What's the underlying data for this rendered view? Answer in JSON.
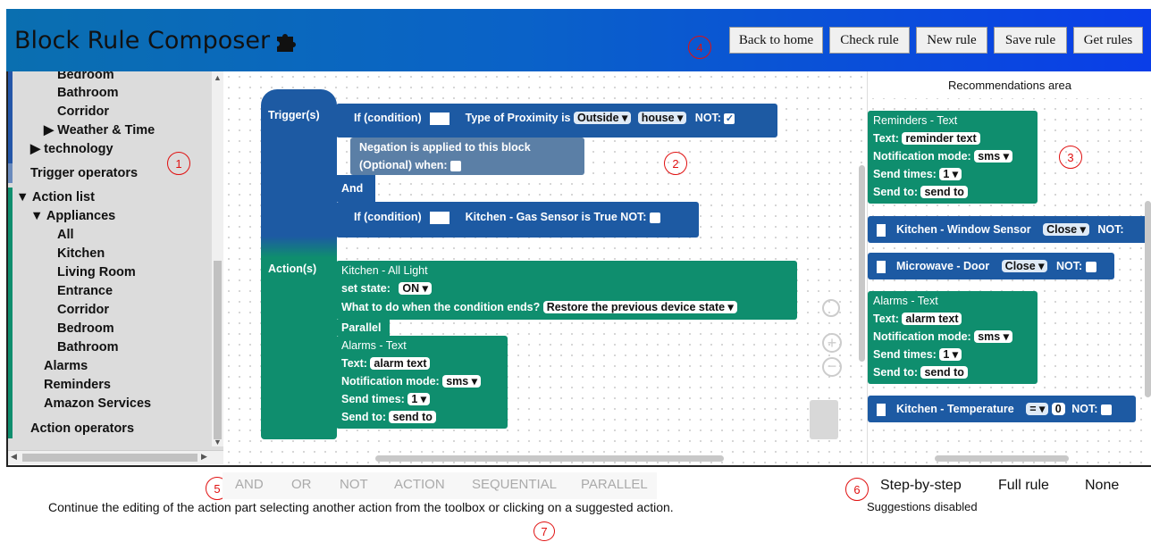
{
  "header": {
    "title": "Block Rule Composer",
    "buttons": [
      "Back to home",
      "Check rule",
      "New rule",
      "Save rule",
      "Get rules"
    ],
    "icon": "puzzle-piece-icon"
  },
  "markers": [
    "1",
    "2",
    "3",
    "4",
    "5",
    "6",
    "7"
  ],
  "toolbox": {
    "items": [
      "Bedroom",
      "Bathroom",
      "Corridor",
      "▶ Weather & Time",
      "▶ technology",
      "Trigger operators",
      "▼ Action list",
      "▼ Appliances",
      "All",
      "Kitchen",
      "Living Room",
      "Entrance",
      "Corridor",
      "Bedroom",
      "Bathroom",
      "Alarms",
      "Reminders",
      "Amazon Services",
      "Action operators"
    ]
  },
  "canvas": {
    "triggers_label": "Trigger(s)",
    "actions_label": "Action(s)",
    "if1": {
      "label": "If (condition)",
      "text": "Type of Proximity  is",
      "dd1": "Outside ▾",
      "dd2": "house ▾",
      "not": "NOT:",
      "check": "✓"
    },
    "negation": {
      "line1": "Negation is applied to this block",
      "line2": "(Optional) when:"
    },
    "and_label": "And",
    "if2": {
      "label": "If (condition)",
      "text": "Kitchen - Gas Sensor  is  True   NOT:"
    },
    "action1": {
      "title": "Kitchen - All Light",
      "set_state": "set state:",
      "state_dd": "ON ▾",
      "end_q": "What to do when the condition ends?",
      "end_dd": "Restore the previous device state ▾"
    },
    "parallel_label": "Parallel",
    "action2": {
      "title": "Alarms - Text",
      "text_label": "Text:",
      "text_val": "alarm text",
      "mode_label": "Notification mode:",
      "mode_dd": "sms ▾",
      "times_label": "Send times:",
      "times_dd": "1 ▾",
      "to_label": "Send to:",
      "to_val": "send to"
    }
  },
  "recommendations": {
    "title": "Recommendations area",
    "reminder": {
      "title": "Reminders - Text",
      "text_label": "Text:",
      "text_val": "reminder text",
      "mode_label": "Notification mode:",
      "mode_dd": "sms ▾",
      "times_label": "Send times:",
      "times_dd": "1 ▾",
      "to_label": "Send to:",
      "to_val": "send to"
    },
    "window": {
      "text": "Kitchen - Window Sensor",
      "dd": "Close ▾",
      "not": "NOT:"
    },
    "microwave": {
      "text": "Microwave - Door",
      "dd": "Close ▾",
      "not": "NOT:"
    },
    "alarm": {
      "title": "Alarms - Text",
      "text_label": "Text:",
      "text_val": "alarm text",
      "mode_label": "Notification mode:",
      "mode_dd": "sms ▾",
      "times_label": "Send times:",
      "times_dd": "1 ▾",
      "to_label": "Send to:",
      "to_val": "send to"
    },
    "temperature": {
      "text": "Kitchen - Temperature",
      "dd": "= ▾",
      "val": "0",
      "not": "NOT:"
    }
  },
  "footer": {
    "operators": [
      "AND",
      "OR",
      "NOT",
      "ACTION",
      "SEQUENTIAL",
      "PARALLEL"
    ],
    "modes": [
      "Step-by-step",
      "Full rule",
      "None"
    ],
    "suggestions_status": "Suggestions disabled",
    "message": "Continue the editing of the action part selecting another action from the toolbox or clicking on a suggested action."
  },
  "colors": {
    "action": "#0f8e6e",
    "trigger": "#1d5aa3",
    "negation": "#5b7fa6",
    "marker": "#e01010"
  }
}
